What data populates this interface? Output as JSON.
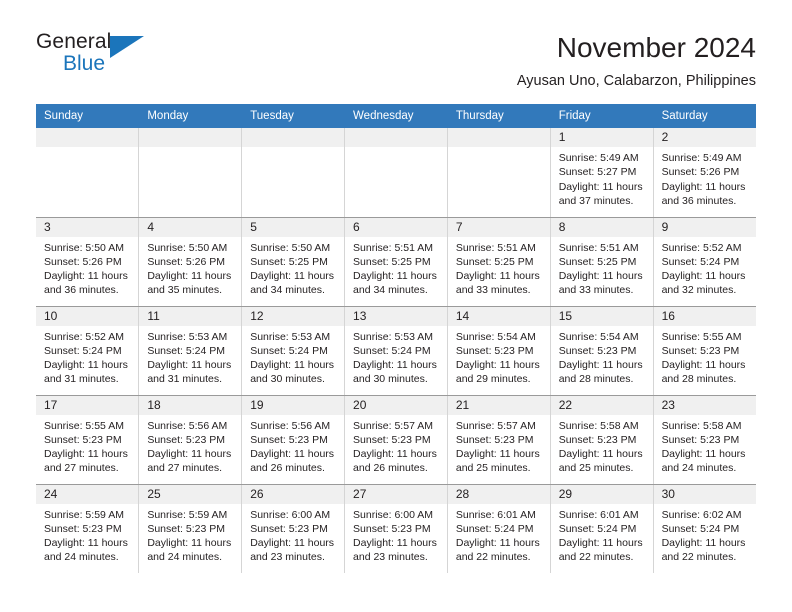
{
  "logo": {
    "word1": "General",
    "word2": "Blue",
    "triangle_color": "#1b75bb"
  },
  "header": {
    "title": "November 2024",
    "location": "Ayusan Uno, Calabarzon, Philippines"
  },
  "calendar": {
    "header_bg": "#3279bb",
    "weekdays": [
      "Sunday",
      "Monday",
      "Tuesday",
      "Wednesday",
      "Thursday",
      "Friday",
      "Saturday"
    ],
    "labels": {
      "sunrise": "Sunrise:",
      "sunset": "Sunset:",
      "daylight": "Daylight:"
    },
    "weeks": [
      [
        {
          "day": "",
          "empty": true
        },
        {
          "day": "",
          "empty": true
        },
        {
          "day": "",
          "empty": true
        },
        {
          "day": "",
          "empty": true
        },
        {
          "day": "",
          "empty": true
        },
        {
          "day": "1",
          "sunrise": "Sunrise: 5:49 AM",
          "sunset": "Sunset: 5:27 PM",
          "daylight": "Daylight: 11 hours and 37 minutes."
        },
        {
          "day": "2",
          "sunrise": "Sunrise: 5:49 AM",
          "sunset": "Sunset: 5:26 PM",
          "daylight": "Daylight: 11 hours and 36 minutes."
        }
      ],
      [
        {
          "day": "3",
          "sunrise": "Sunrise: 5:50 AM",
          "sunset": "Sunset: 5:26 PM",
          "daylight": "Daylight: 11 hours and 36 minutes."
        },
        {
          "day": "4",
          "sunrise": "Sunrise: 5:50 AM",
          "sunset": "Sunset: 5:26 PM",
          "daylight": "Daylight: 11 hours and 35 minutes."
        },
        {
          "day": "5",
          "sunrise": "Sunrise: 5:50 AM",
          "sunset": "Sunset: 5:25 PM",
          "daylight": "Daylight: 11 hours and 34 minutes."
        },
        {
          "day": "6",
          "sunrise": "Sunrise: 5:51 AM",
          "sunset": "Sunset: 5:25 PM",
          "daylight": "Daylight: 11 hours and 34 minutes."
        },
        {
          "day": "7",
          "sunrise": "Sunrise: 5:51 AM",
          "sunset": "Sunset: 5:25 PM",
          "daylight": "Daylight: 11 hours and 33 minutes."
        },
        {
          "day": "8",
          "sunrise": "Sunrise: 5:51 AM",
          "sunset": "Sunset: 5:25 PM",
          "daylight": "Daylight: 11 hours and 33 minutes."
        },
        {
          "day": "9",
          "sunrise": "Sunrise: 5:52 AM",
          "sunset": "Sunset: 5:24 PM",
          "daylight": "Daylight: 11 hours and 32 minutes."
        }
      ],
      [
        {
          "day": "10",
          "sunrise": "Sunrise: 5:52 AM",
          "sunset": "Sunset: 5:24 PM",
          "daylight": "Daylight: 11 hours and 31 minutes."
        },
        {
          "day": "11",
          "sunrise": "Sunrise: 5:53 AM",
          "sunset": "Sunset: 5:24 PM",
          "daylight": "Daylight: 11 hours and 31 minutes."
        },
        {
          "day": "12",
          "sunrise": "Sunrise: 5:53 AM",
          "sunset": "Sunset: 5:24 PM",
          "daylight": "Daylight: 11 hours and 30 minutes."
        },
        {
          "day": "13",
          "sunrise": "Sunrise: 5:53 AM",
          "sunset": "Sunset: 5:24 PM",
          "daylight": "Daylight: 11 hours and 30 minutes."
        },
        {
          "day": "14",
          "sunrise": "Sunrise: 5:54 AM",
          "sunset": "Sunset: 5:23 PM",
          "daylight": "Daylight: 11 hours and 29 minutes."
        },
        {
          "day": "15",
          "sunrise": "Sunrise: 5:54 AM",
          "sunset": "Sunset: 5:23 PM",
          "daylight": "Daylight: 11 hours and 28 minutes."
        },
        {
          "day": "16",
          "sunrise": "Sunrise: 5:55 AM",
          "sunset": "Sunset: 5:23 PM",
          "daylight": "Daylight: 11 hours and 28 minutes."
        }
      ],
      [
        {
          "day": "17",
          "sunrise": "Sunrise: 5:55 AM",
          "sunset": "Sunset: 5:23 PM",
          "daylight": "Daylight: 11 hours and 27 minutes."
        },
        {
          "day": "18",
          "sunrise": "Sunrise: 5:56 AM",
          "sunset": "Sunset: 5:23 PM",
          "daylight": "Daylight: 11 hours and 27 minutes."
        },
        {
          "day": "19",
          "sunrise": "Sunrise: 5:56 AM",
          "sunset": "Sunset: 5:23 PM",
          "daylight": "Daylight: 11 hours and 26 minutes."
        },
        {
          "day": "20",
          "sunrise": "Sunrise: 5:57 AM",
          "sunset": "Sunset: 5:23 PM",
          "daylight": "Daylight: 11 hours and 26 minutes."
        },
        {
          "day": "21",
          "sunrise": "Sunrise: 5:57 AM",
          "sunset": "Sunset: 5:23 PM",
          "daylight": "Daylight: 11 hours and 25 minutes."
        },
        {
          "day": "22",
          "sunrise": "Sunrise: 5:58 AM",
          "sunset": "Sunset: 5:23 PM",
          "daylight": "Daylight: 11 hours and 25 minutes."
        },
        {
          "day": "23",
          "sunrise": "Sunrise: 5:58 AM",
          "sunset": "Sunset: 5:23 PM",
          "daylight": "Daylight: 11 hours and 24 minutes."
        }
      ],
      [
        {
          "day": "24",
          "sunrise": "Sunrise: 5:59 AM",
          "sunset": "Sunset: 5:23 PM",
          "daylight": "Daylight: 11 hours and 24 minutes."
        },
        {
          "day": "25",
          "sunrise": "Sunrise: 5:59 AM",
          "sunset": "Sunset: 5:23 PM",
          "daylight": "Daylight: 11 hours and 24 minutes."
        },
        {
          "day": "26",
          "sunrise": "Sunrise: 6:00 AM",
          "sunset": "Sunset: 5:23 PM",
          "daylight": "Daylight: 11 hours and 23 minutes."
        },
        {
          "day": "27",
          "sunrise": "Sunrise: 6:00 AM",
          "sunset": "Sunset: 5:23 PM",
          "daylight": "Daylight: 11 hours and 23 minutes."
        },
        {
          "day": "28",
          "sunrise": "Sunrise: 6:01 AM",
          "sunset": "Sunset: 5:24 PM",
          "daylight": "Daylight: 11 hours and 22 minutes."
        },
        {
          "day": "29",
          "sunrise": "Sunrise: 6:01 AM",
          "sunset": "Sunset: 5:24 PM",
          "daylight": "Daylight: 11 hours and 22 minutes."
        },
        {
          "day": "30",
          "sunrise": "Sunrise: 6:02 AM",
          "sunset": "Sunset: 5:24 PM",
          "daylight": "Daylight: 11 hours and 22 minutes."
        }
      ]
    ]
  }
}
